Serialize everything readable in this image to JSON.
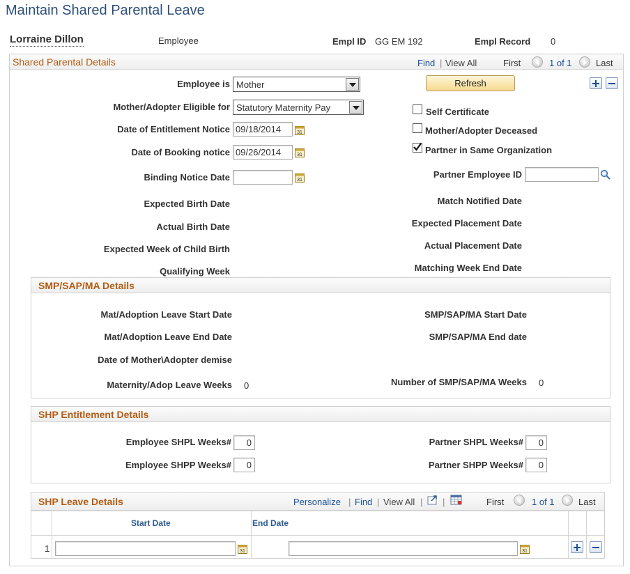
{
  "page_title": "Maintain Shared Parental Leave",
  "employee": {
    "name": "Lorraine Dillon",
    "role": "Employee",
    "empl_id_label": "Empl ID",
    "empl_id": "GG EM 192",
    "empl_record_label": "Empl Record",
    "empl_record": "0"
  },
  "main_grid": {
    "title": "Shared Parental Details",
    "find": "Find",
    "view_all": "View All",
    "first": "First",
    "counter": "1 of 1",
    "last": "Last"
  },
  "form": {
    "employee_is_label": "Employee is",
    "employee_is_value": "Mother",
    "refresh_label": "Refresh",
    "eligible_label": "Mother/Adopter Eligible for",
    "eligible_value": "Statutory Maternity Pay",
    "entitlement_label": "Date of Entitlement Notice",
    "entitlement_value": "09/18/2014",
    "booking_label": "Date of Booking notice",
    "booking_value": "09/26/2014",
    "binding_label": "Binding Notice Date",
    "binding_value": "",
    "expected_birth_label": "Expected Birth Date",
    "actual_birth_label": "Actual Birth Date",
    "expected_week_label": "Expected Week of Child Birth",
    "qualifying_week_label": "Qualifying Week",
    "self_cert_label": "Self Certificate",
    "self_cert_checked": false,
    "deceased_label": "Mother/Adopter Deceased",
    "deceased_checked": false,
    "partner_same_org_label": "Partner in Same Organization",
    "partner_same_org_checked": true,
    "partner_empl_id_label": "Partner Employee ID",
    "partner_empl_id_value": "",
    "match_notified_label": "Match Notified Date",
    "expected_placement_label": "Expected Placement Date",
    "actual_placement_label": "Actual Placement Date",
    "matching_week_end_label": "Matching Week End Date"
  },
  "smp": {
    "title": "SMP/SAP/MA Details",
    "leave_start_label": "Mat/Adoption Leave Start Date",
    "leave_end_label": "Mat/Adoption Leave End Date",
    "demise_label": "Date of Mother\\Adopter demise",
    "leave_weeks_label": "Maternity/Adop Leave Weeks",
    "leave_weeks_value": "0",
    "start_label": "SMP/SAP/MA Start Date",
    "end_label": "SMP/SAP/MA End date",
    "num_weeks_label": "Number of SMP/SAP/MA Weeks",
    "num_weeks_value": "0"
  },
  "shp_ent": {
    "title": "SHP Entitlement Details",
    "emp_shpl_label": "Employee SHPL Weeks#",
    "emp_shpl_value": "0",
    "emp_shpp_label": "Employee SHPP Weeks#",
    "emp_shpp_value": "0",
    "partner_shpl_label": "Partner SHPL Weeks#",
    "partner_shpl_value": "0",
    "partner_shpp_label": "Partner SHPP Weeks#",
    "partner_shpp_value": "0"
  },
  "shp_leave": {
    "title": "SHP Leave Details",
    "personalize": "Personalize",
    "find": "Find",
    "view_all": "View All",
    "first": "First",
    "counter": "1 of 1",
    "last": "Last",
    "col_start": "Start Date",
    "col_end": "End Date",
    "rows": [
      {
        "num": "1",
        "start": "",
        "end": ""
      }
    ]
  }
}
